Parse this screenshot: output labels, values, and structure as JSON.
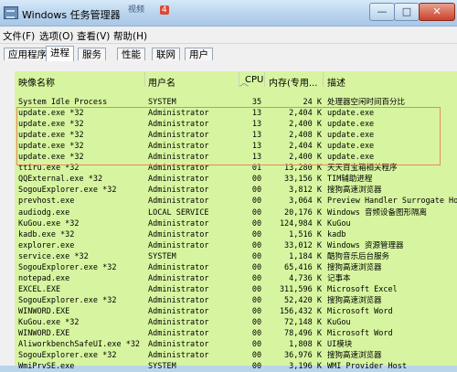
{
  "window": {
    "title": "Windows 任务管理器"
  },
  "title_buttons": {
    "min": "—",
    "max": "□",
    "close": "✕"
  },
  "bg_tabs": [
    "视频",
    "",
    "",
    "4"
  ],
  "menu": [
    "文件(F)",
    "选项(O)",
    "查看(V)",
    "帮助(H)"
  ],
  "tabs": [
    "应用程序",
    "进程",
    "服务",
    "性能",
    "联网",
    "用户"
  ],
  "active_tab": "进程",
  "columns": {
    "name": "映像名称",
    "user": "用户名",
    "cpu": "CPU",
    "mem": "内存(专用...",
    "desc": "描述"
  },
  "colors": {
    "table_bg": "#d7f5a0",
    "highlight_border": "#e8875c"
  },
  "processes": [
    {
      "name": "System Idle Process",
      "user": "SYSTEM",
      "cpu": "35",
      "mem": "24 K",
      "desc": "处理器空闲时间百分比"
    },
    {
      "name": "update.exe *32",
      "user": "Administrator",
      "cpu": "13",
      "mem": "2,404 K",
      "desc": "update.exe"
    },
    {
      "name": "update.exe *32",
      "user": "Administrator",
      "cpu": "13",
      "mem": "2,400 K",
      "desc": "update.exe"
    },
    {
      "name": "update.exe *32",
      "user": "Administrator",
      "cpu": "13",
      "mem": "2,408 K",
      "desc": "update.exe"
    },
    {
      "name": "update.exe *32",
      "user": "Administrator",
      "cpu": "13",
      "mem": "2,404 K",
      "desc": "update.exe"
    },
    {
      "name": "update.exe *32",
      "user": "Administrator",
      "cpu": "13",
      "mem": "2,400 K",
      "desc": "update.exe"
    },
    {
      "name": "ttiru.exe *32",
      "user": "Administrator",
      "cpu": "01",
      "mem": "13,280 K",
      "desc": "天天百宝箱相关程序"
    },
    {
      "name": "QQExternal.exe *32",
      "user": "Administrator",
      "cpu": "00",
      "mem": "33,156 K",
      "desc": "TIM辅助进程"
    },
    {
      "name": "SogouExplorer.exe *32",
      "user": "Administrator",
      "cpu": "00",
      "mem": "3,812 K",
      "desc": "搜狗高速浏览器"
    },
    {
      "name": "prevhost.exe",
      "user": "Administrator",
      "cpu": "00",
      "mem": "3,064 K",
      "desc": "Preview Handler Surrogate Host"
    },
    {
      "name": "audiodg.exe",
      "user": "LOCAL SERVICE",
      "cpu": "00",
      "mem": "20,176 K",
      "desc": "Windows 音频设备图形隔离"
    },
    {
      "name": "KuGou.exe *32",
      "user": "Administrator",
      "cpu": "00",
      "mem": "124,984 K",
      "desc": "KuGou"
    },
    {
      "name": "kadb.exe *32",
      "user": "Administrator",
      "cpu": "00",
      "mem": "1,516 K",
      "desc": "kadb"
    },
    {
      "name": "explorer.exe",
      "user": "Administrator",
      "cpu": "00",
      "mem": "33,012 K",
      "desc": "Windows 资源管理器"
    },
    {
      "name": "service.exe *32",
      "user": "SYSTEM",
      "cpu": "00",
      "mem": "1,184 K",
      "desc": "酷狗音乐后台服务"
    },
    {
      "name": "SogouExplorer.exe *32",
      "user": "Administrator",
      "cpu": "00",
      "mem": "65,416 K",
      "desc": "搜狗高速浏览器"
    },
    {
      "name": "notepad.exe",
      "user": "Administrator",
      "cpu": "00",
      "mem": "4,736 K",
      "desc": "记事本"
    },
    {
      "name": "EXCEL.EXE",
      "user": "Administrator",
      "cpu": "00",
      "mem": "311,596 K",
      "desc": "Microsoft Excel"
    },
    {
      "name": "SogouExplorer.exe *32",
      "user": "Administrator",
      "cpu": "00",
      "mem": "52,420 K",
      "desc": "搜狗高速浏览器"
    },
    {
      "name": "WINWORD.EXE",
      "user": "Administrator",
      "cpu": "00",
      "mem": "156,432 K",
      "desc": "Microsoft Word"
    },
    {
      "name": "KuGou.exe *32",
      "user": "Administrator",
      "cpu": "00",
      "mem": "72,148 K",
      "desc": "KuGou"
    },
    {
      "name": "WINWORD.EXE",
      "user": "Administrator",
      "cpu": "00",
      "mem": "78,496 K",
      "desc": "Microsoft Word"
    },
    {
      "name": "AliworkbenchSafeUI.exe *32",
      "user": "Administrator",
      "cpu": "00",
      "mem": "1,808 K",
      "desc": "UI模块"
    },
    {
      "name": "SogouExplorer.exe *32",
      "user": "Administrator",
      "cpu": "00",
      "mem": "36,976 K",
      "desc": "搜狗高速浏览器"
    },
    {
      "name": "WmiPrvSE.exe",
      "user": "SYSTEM",
      "cpu": "00",
      "mem": "3,196 K",
      "desc": "WMI Provider Host"
    }
  ]
}
